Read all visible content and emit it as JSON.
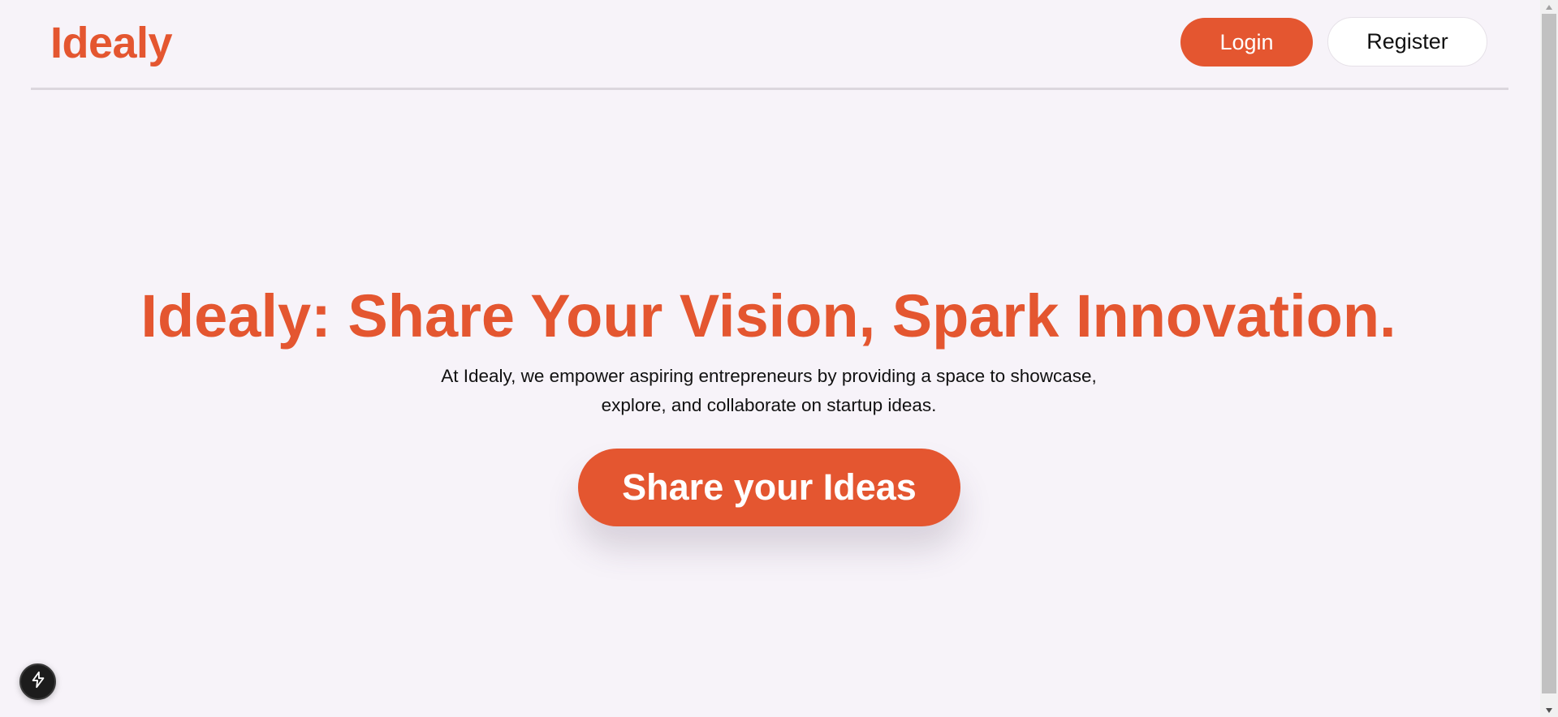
{
  "header": {
    "logo": "Idealy",
    "login_label": "Login",
    "register_label": "Register"
  },
  "hero": {
    "title": "Idealy: Share Your Vision, Spark Innovation.",
    "subtitle": "At Idealy, we empower aspiring entrepreneurs by providing a space to showcase, explore, and collaborate on startup ideas.",
    "cta_label": "Share your Ideas"
  },
  "floating_button": {
    "icon": "lightning-bolt-icon"
  },
  "colors": {
    "accent": "#e45630",
    "background": "#f7f3f9"
  }
}
